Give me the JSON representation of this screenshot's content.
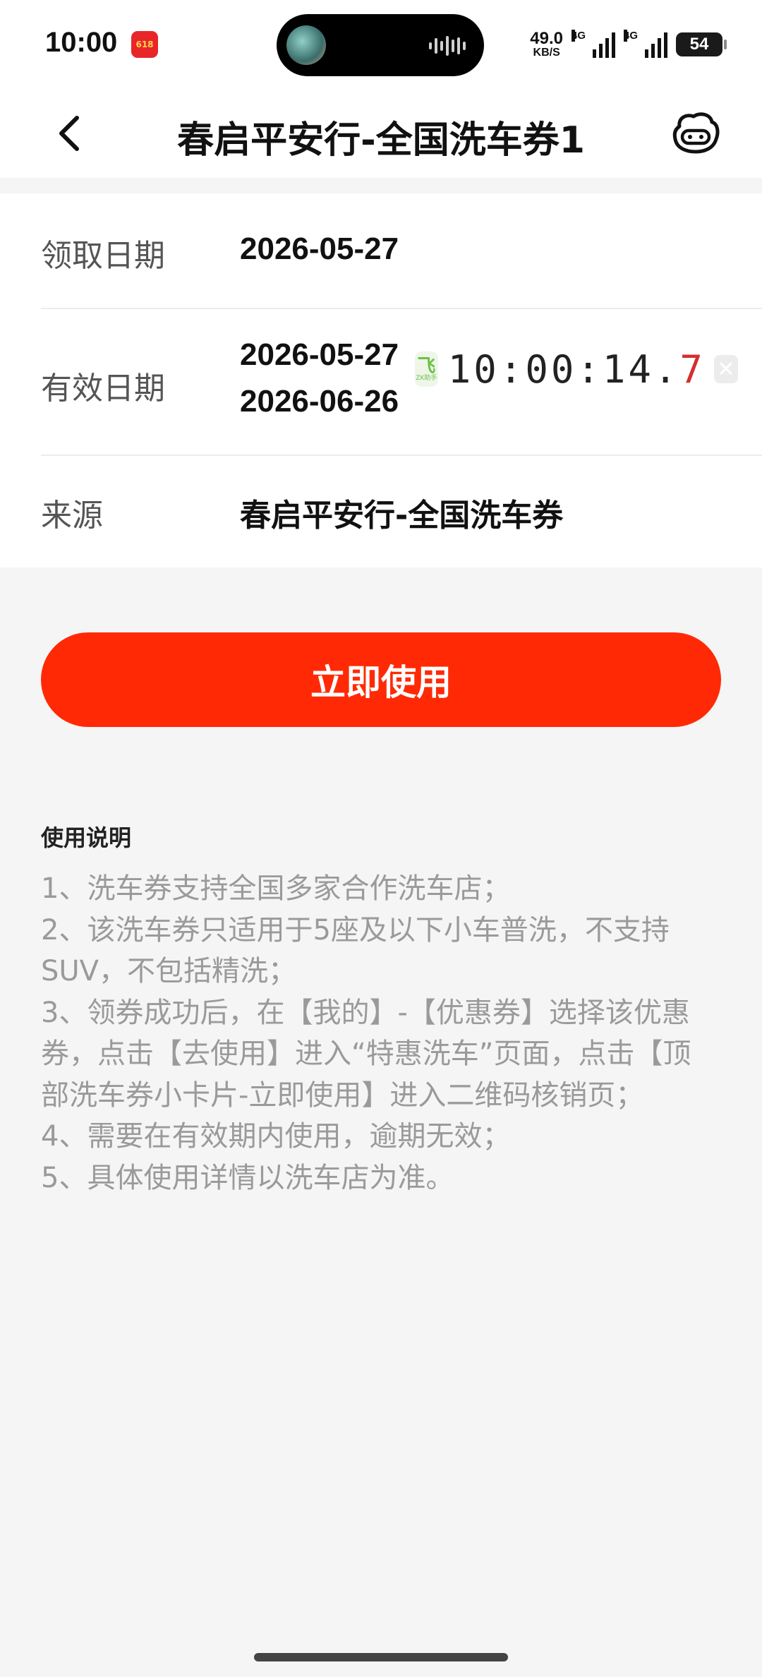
{
  "status_bar": {
    "time": "10:00",
    "app_badge": "618",
    "net_speed_value": "49.0",
    "net_speed_unit": "KB/S",
    "signal1_label": "4G",
    "signal2_label": "4G",
    "battery": "54"
  },
  "header": {
    "title": "春启平安行-全国洗车券1"
  },
  "info": {
    "received_label": "领取日期",
    "received_value": "2026-05-27",
    "valid_label": "有效日期",
    "valid_start": "2026-05-27",
    "valid_end": "2026-06-26",
    "source_label": "来源",
    "source_value": "春启平安行-全国洗车券"
  },
  "timer_widget": {
    "app_icon_glyph": "飞",
    "app_icon_sub": "ZK助手",
    "time_main": "10:00:14.",
    "time_tenth": "7",
    "close_glyph": "✕"
  },
  "primary_button": {
    "label": "立即使用"
  },
  "instructions": {
    "title": "使用说明",
    "items": [
      "1、洗车券支持全国多家合作洗车店；",
      "2、该洗车券只适用于5座及以下小车普洗，不支持SUV，不包括精洗；",
      "3、领券成功后，在【我的】-【优惠券】选择该优惠券，点击【去使用】进入“特惠洗车”页面，点击【顶部洗车券小卡片-立即使用】进入二维码核销页；",
      "4、需要在有效期内使用，逾期无效；",
      "5、具体使用详情以洗车店为准。"
    ]
  },
  "colors": {
    "accent": "#ff2a05",
    "timer_highlight": "#d32f2f"
  },
  "icons": {
    "back": "back-arrow-icon",
    "assistant": "robot-assistant-icon"
  }
}
